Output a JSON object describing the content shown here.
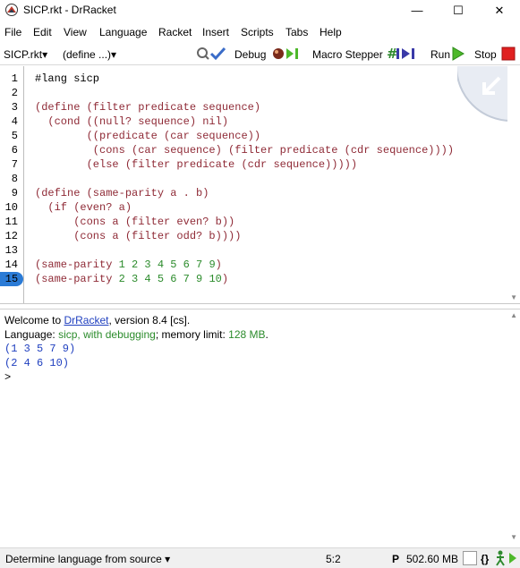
{
  "window": {
    "title": "SICP.rkt - DrRacket",
    "minimize": "—",
    "maximize": "☐",
    "close": "✕"
  },
  "menu": [
    "File",
    "Edit",
    "View",
    "Language",
    "Racket",
    "Insert",
    "Scripts",
    "Tabs",
    "Help"
  ],
  "toolbar": {
    "file_selector": "SICP.rkt▾",
    "define_selector": "(define ...)▾",
    "debug_label": "Debug",
    "macro_stepper_label": "Macro Stepper",
    "run_label": "Run",
    "stop_label": "Stop"
  },
  "editor": {
    "line_numbers": [
      "1",
      "2",
      "3",
      "4",
      "5",
      "6",
      "7",
      "8",
      "9",
      "10",
      "11",
      "12",
      "13",
      "14",
      "15"
    ],
    "active_line": "15",
    "lines": [
      "#lang sicp",
      "",
      "(define (filter predicate sequence)",
      "  (cond ((null? sequence) nil)",
      "        ((predicate (car sequence))",
      "         (cons (car sequence) (filter predicate (cdr sequence))))",
      "        (else (filter predicate (cdr sequence)))))",
      "",
      "(define (same-parity a . b)",
      "  (if (even? a)",
      "      (cons a (filter even? b))",
      "      (cons a (filter odd? b))))",
      "",
      "(same-parity 1 2 3 4 5 6 7 9)",
      "(same-parity 2 3 4 5 6 7 9 10)"
    ]
  },
  "repl": {
    "welcome_prefix": "Welcome to ",
    "welcome_link": "DrRacket",
    "welcome_suffix": ", version 8.4 [cs].",
    "language_prefix": "Language: ",
    "language_value": "sicp, with debugging",
    "memory_prefix": "; memory limit: ",
    "memory_value": "128 MB",
    "memory_suffix": ".",
    "outputs": [
      "(1 3 5 7 9)",
      "(2 4 6 10)"
    ],
    "prompt": ">"
  },
  "status": {
    "language_selector": "Determine language from source ▾",
    "position": "5:2",
    "p_label": "P",
    "memory": "502.60 MB",
    "braces": "{}"
  },
  "colors": {
    "keyword": "#8f2a36",
    "number": "#2b8b2b",
    "repl_output": "#1f3fbf",
    "active_line": "#2b7bd6"
  }
}
